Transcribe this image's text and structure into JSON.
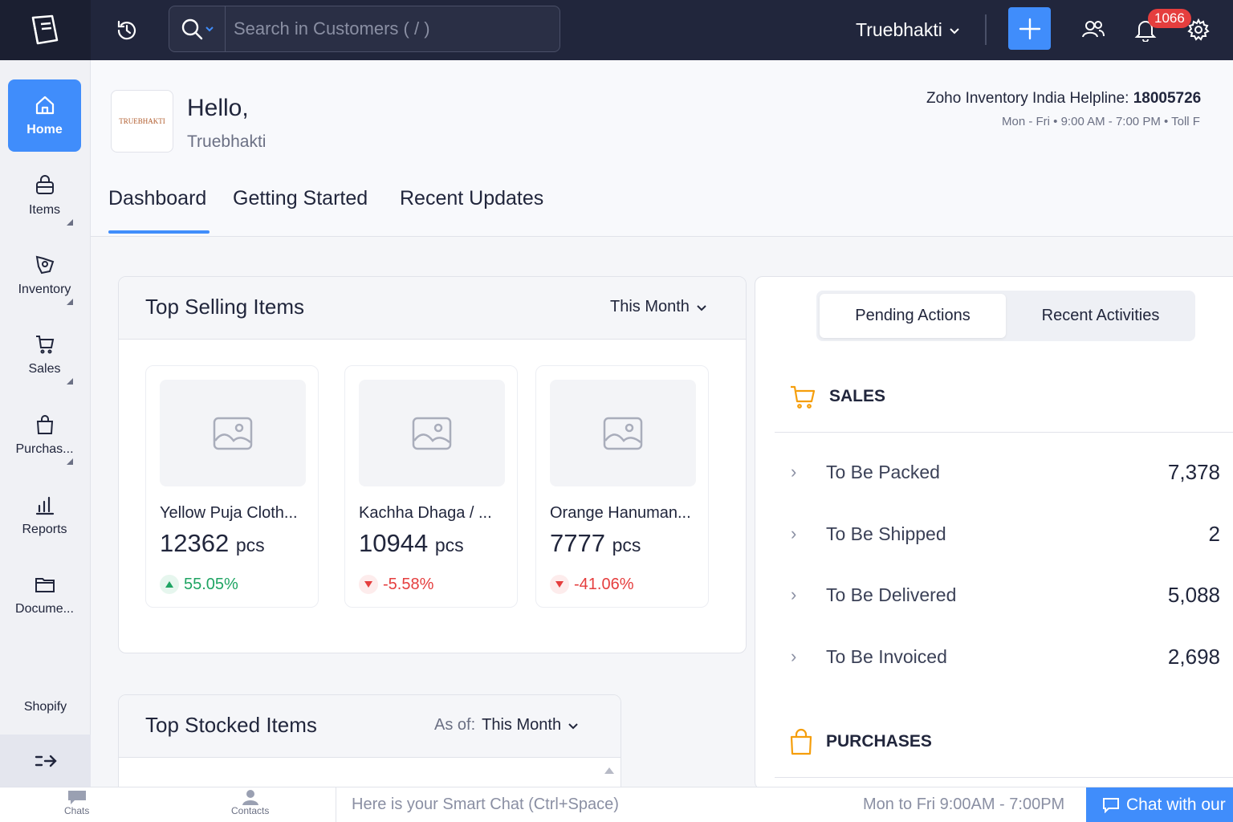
{
  "search": {
    "placeholder": "Search in Customers ( / )"
  },
  "topbar": {
    "org_name": "Truebhakti",
    "notification_count": "1066"
  },
  "sidebar": {
    "items": [
      {
        "label": "Home"
      },
      {
        "label": "Items"
      },
      {
        "label": "Inventory"
      },
      {
        "label": "Sales"
      },
      {
        "label": "Purchas..."
      },
      {
        "label": "Reports"
      },
      {
        "label": "Docume..."
      }
    ],
    "shopify": "Shopify"
  },
  "header": {
    "logo_text": "TRUEBHAKTI",
    "greeting": "Hello,",
    "org": "Truebhakti",
    "helpline_label": "Zoho Inventory India Helpline: ",
    "helpline_number": "18005726",
    "helpline_hours": "Mon - Fri • 9:00 AM - 7:00 PM • Toll F"
  },
  "tabs": [
    {
      "label": "Dashboard"
    },
    {
      "label": "Getting Started"
    },
    {
      "label": "Recent Updates"
    }
  ],
  "top_selling": {
    "title": "Top Selling Items",
    "filter": "This Month",
    "items": [
      {
        "name": "Yellow Puja Cloth...",
        "qty": "12362",
        "unit": "pcs",
        "change": "55.05%"
      },
      {
        "name": "Kachha Dhaga / ...",
        "qty": "10944",
        "unit": "pcs",
        "change": "-5.58%"
      },
      {
        "name": "Orange Hanuman...",
        "qty": "7777",
        "unit": "pcs",
        "change": "-41.06%"
      }
    ]
  },
  "top_stocked": {
    "title": "Top Stocked Items",
    "filter_label": "As of:",
    "filter": "This Month"
  },
  "right_panel": {
    "tabs": [
      {
        "label": "Pending Actions"
      },
      {
        "label": "Recent Activities"
      }
    ],
    "sales_title": "SALES",
    "sales_rows": [
      {
        "label": "To Be Packed",
        "value": "7,378"
      },
      {
        "label": "To Be Shipped",
        "value": "2"
      },
      {
        "label": "To Be Delivered",
        "value": "5,088"
      },
      {
        "label": "To Be Invoiced",
        "value": "2,698"
      }
    ],
    "purchases_title": "PURCHASES"
  },
  "bottombar": {
    "chats": "Chats",
    "contacts": "Contacts",
    "smart_chat": "Here is your Smart Chat (Ctrl+Space)",
    "hours": "Mon to Fri 9:00AM - 7:00PM",
    "chat_button": "Chat with our"
  },
  "colors": {
    "accent": "#408dfb",
    "topbar": "#21263c",
    "up": "#1fa463",
    "down": "#e53e3e",
    "sales_icon": "#f59e0b"
  }
}
